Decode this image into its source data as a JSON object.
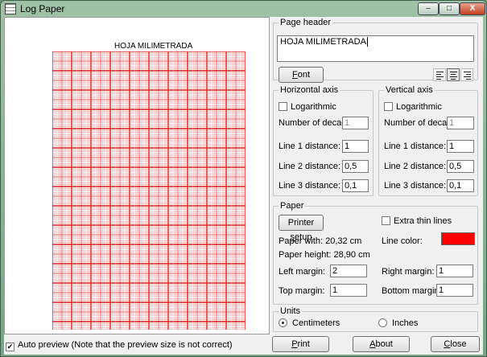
{
  "window": {
    "title": "Log Paper",
    "min_glyph": "–",
    "max_glyph": "□",
    "close_glyph": "X"
  },
  "preview": {
    "title": "HOJA MILIMETRADA",
    "line_color": "#e02020"
  },
  "auto_preview": {
    "checked": true,
    "label": "Auto preview (Note that the preview size is not correct)"
  },
  "page_header": {
    "legend": "Page header",
    "text": "HOJA MILIMETRADA",
    "font_button": {
      "prefix": "",
      "underline": "F",
      "rest": "ont"
    },
    "alignment": [
      "left",
      "center",
      "right"
    ],
    "alignment_selected": "center"
  },
  "horizontal_axis": {
    "legend": "Horizontal axis",
    "logarithmic_label": "Logarithmic",
    "logarithmic": false,
    "decades_label": "Number of decades:",
    "decades": "1",
    "line1_label": "Line 1 distance:",
    "line1": "1",
    "line2_label": "Line 2 distance:",
    "line2": "0,5",
    "line3_label": "Line 3 distance:",
    "line3": "0,1"
  },
  "vertical_axis": {
    "legend": "Vertical axis",
    "logarithmic_label": "Logarithmic",
    "logarithmic": false,
    "decades_label": "Number of decades:",
    "decades": "1",
    "line1_label": "Line 1 distance:",
    "line1": "1",
    "line2_label": "Line 2 distance:",
    "line2": "0,5",
    "line3_label": "Line 3 distance:",
    "line3": "0,1"
  },
  "paper": {
    "legend": "Paper",
    "printer_setup": {
      "prefix": "Printer ",
      "underline": "s",
      "rest": "etup"
    },
    "extra_thin_label": "Extra thin lines",
    "extra_thin": false,
    "width_text": "Paper with: 20,32 cm",
    "height_text": "Paper height: 28,90 cm",
    "line_color_label": "Line color:",
    "line_color": "#ff0000",
    "left_margin_label": "Left margin:",
    "left_margin": "2",
    "right_margin_label": "Right margin:",
    "right_margin": "1",
    "top_margin_label": "Top margin:",
    "top_margin": "1",
    "bottom_margin_label": "Bottom margin:",
    "bottom_margin": "1"
  },
  "units": {
    "legend": "Units",
    "options": [
      "Centimeters",
      "Inches"
    ],
    "selected": "Centimeters"
  },
  "buttons": {
    "print": {
      "prefix": "",
      "underline": "P",
      "rest": "rint"
    },
    "about": {
      "prefix": "",
      "underline": "A",
      "rest": "bout"
    },
    "close": {
      "prefix": "",
      "underline": "C",
      "rest": "lose"
    }
  }
}
